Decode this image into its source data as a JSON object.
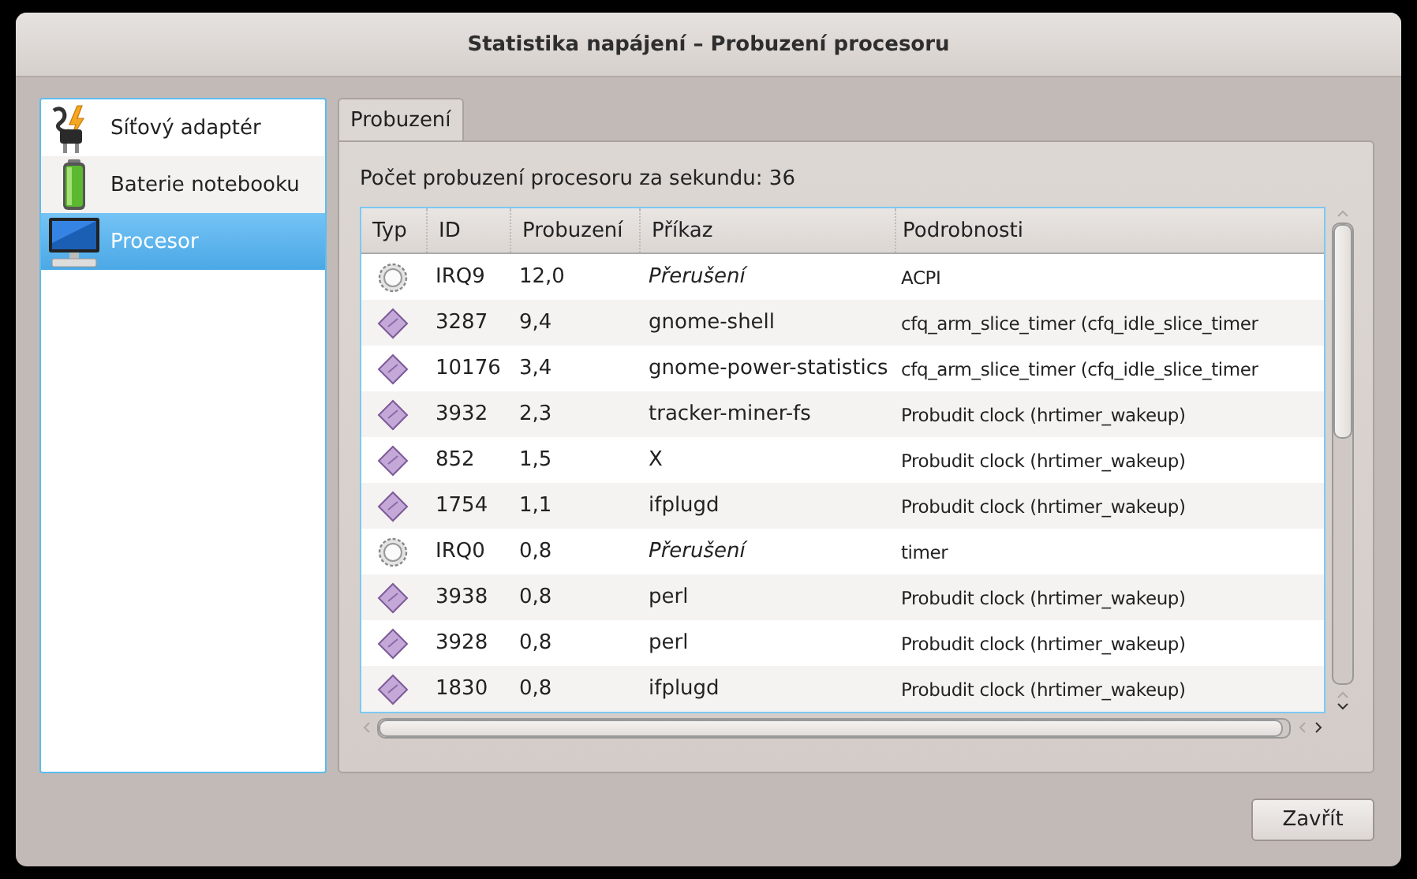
{
  "window": {
    "title": "Statistika napájení – Probuzení procesoru"
  },
  "sidebar": {
    "items": [
      {
        "label": "Síťový adaptér",
        "kind": "adapter",
        "selected": false
      },
      {
        "label": "Baterie notebooku",
        "kind": "battery",
        "selected": false
      },
      {
        "label": "Procesor",
        "kind": "cpu",
        "selected": true
      }
    ]
  },
  "tabs": [
    {
      "label": "Probuzení",
      "selected": true
    }
  ],
  "summary": "Počet probuzení procesoru za sekundu: 36",
  "table": {
    "columns": [
      "Typ",
      "ID",
      "Probuzení",
      "Příkaz",
      "Podrobnosti"
    ],
    "rows": [
      {
        "kind": "interrupt",
        "id": "IRQ9",
        "wakeups": "12,0",
        "command": "Přerušení",
        "details": "ACPI"
      },
      {
        "kind": "process",
        "id": "3287",
        "wakeups": "9,4",
        "command": "gnome-shell",
        "details": "cfq_arm_slice_timer (cfq_idle_slice_timer"
      },
      {
        "kind": "process",
        "id": "10176",
        "wakeups": "3,4",
        "command": "gnome-power-statistics",
        "details": "cfq_arm_slice_timer (cfq_idle_slice_timer"
      },
      {
        "kind": "process",
        "id": "3932",
        "wakeups": "2,3",
        "command": "tracker-miner-fs",
        "details": "Probudit clock (hrtimer_wakeup)"
      },
      {
        "kind": "process",
        "id": "852",
        "wakeups": "1,5",
        "command": "X",
        "details": "Probudit clock (hrtimer_wakeup)"
      },
      {
        "kind": "process",
        "id": "1754",
        "wakeups": "1,1",
        "command": "ifplugd",
        "details": "Probudit clock (hrtimer_wakeup)"
      },
      {
        "kind": "interrupt",
        "id": "IRQ0",
        "wakeups": "0,8",
        "command": "Přerušení",
        "details": "timer"
      },
      {
        "kind": "process",
        "id": "3938",
        "wakeups": "0,8",
        "command": "perl",
        "details": "Probudit clock (hrtimer_wakeup)"
      },
      {
        "kind": "process",
        "id": "3928",
        "wakeups": "0,8",
        "command": "perl",
        "details": "Probudit clock (hrtimer_wakeup)"
      },
      {
        "kind": "process",
        "id": "1830",
        "wakeups": "0,8",
        "command": "ifplugd",
        "details": "Probudit clock (hrtimer_wakeup)"
      }
    ]
  },
  "buttons": [
    "Zavřít"
  ]
}
